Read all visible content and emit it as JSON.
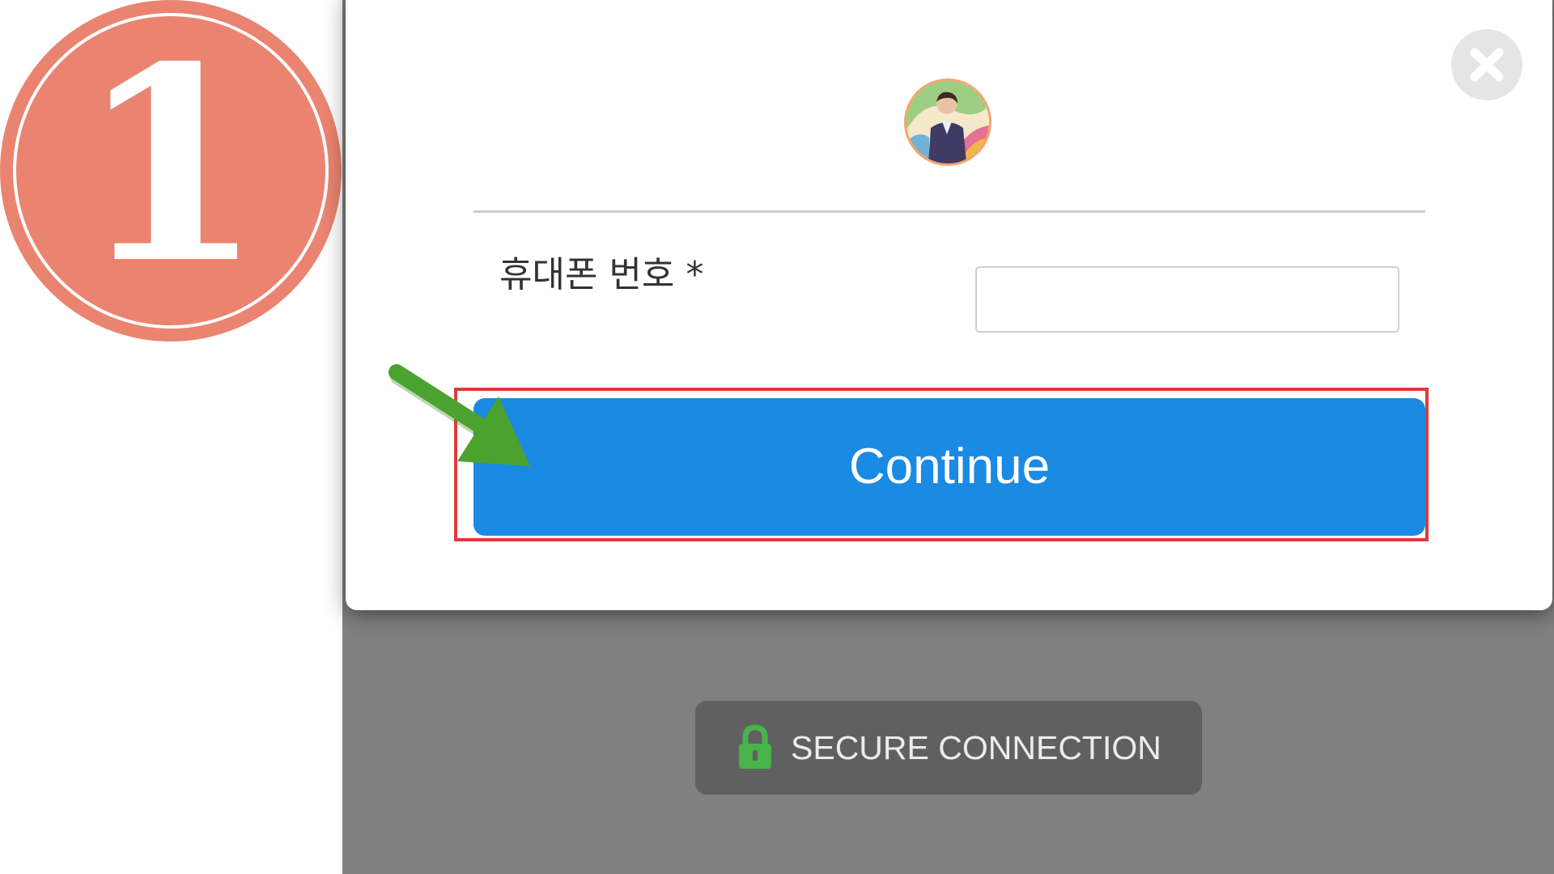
{
  "step_badge": {
    "number": "1",
    "color": "#ea8470"
  },
  "modal": {
    "close_icon": "close-icon",
    "avatar_icon": "profile-avatar-icon",
    "phone_field": {
      "label": "휴대폰 번호 *",
      "value": "",
      "placeholder": ""
    },
    "continue_label": "Continue",
    "accent_color": "#1a8ae3"
  },
  "annotation": {
    "arrow_icon": "green-arrow-icon",
    "arrow_color": "#4ca22f",
    "highlight_color": "#dd3b3b"
  },
  "secure": {
    "icon": "lock-icon",
    "icon_color": "#47b34b",
    "label": "SECURE CONNECTION"
  }
}
